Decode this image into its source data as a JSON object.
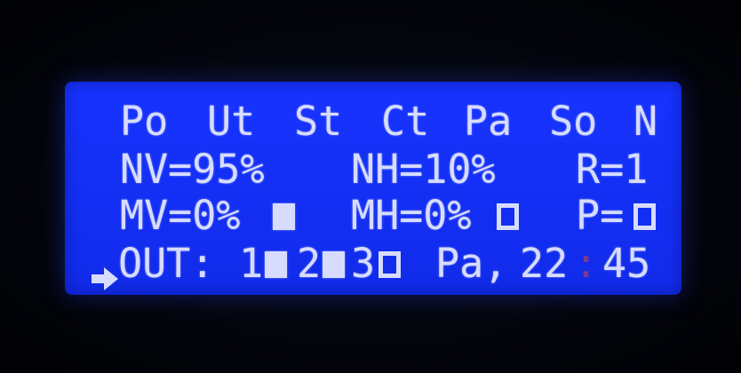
{
  "display": {
    "row1": {
      "po": "Po",
      "ut": "Ut",
      "st": "St",
      "ct": "Ct",
      "pa": "Pa",
      "so": "So",
      "n": "N"
    },
    "row2": {
      "nv": "NV=95%",
      "nh": "NH=10%",
      "r": "R=1"
    },
    "row3": {
      "mv": "MV=0%",
      "mh": "MH=0%",
      "p": "P="
    },
    "row4": {
      "out_label": "OUT:",
      "out1": "1",
      "out2": "2",
      "out3": "3",
      "day": "Pa,",
      "hour": "22",
      "colon": ":",
      "minute": "45"
    }
  },
  "indicators": {
    "mv_state": "filled-square-icon",
    "mh_state": "hollow-square-icon",
    "p_state": "hollow-square-icon",
    "out1_state": "filled-square-icon",
    "out2_state": "filled-square-icon",
    "out3_state": "hollow-square-icon"
  },
  "colors": {
    "backlight": "#1430f6",
    "text": "#d7dcff",
    "dim_colon": "#7a3b8e"
  }
}
